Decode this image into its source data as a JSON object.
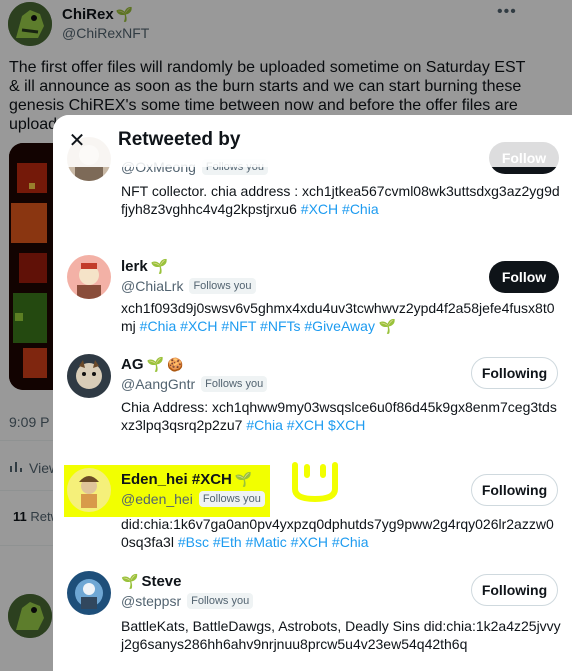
{
  "background_tweet": {
    "author_name": "ChiRex",
    "author_handle": "@ChiRexNFT",
    "more_icon": "more-horizontal-icon",
    "text": "The first offer files will randomly be uploaded sometime on Saturday EST & ill announce as soon as the burn starts and we can start burning these genesis ChiREX's some time between now and before the offer files are upload",
    "time": "9:09 P",
    "views_label": "View",
    "retweet_count": "11",
    "retweets_label": "Retw"
  },
  "modal": {
    "title": "Retweeted by",
    "close_icon": "close-icon",
    "users": [
      {
        "name": "",
        "handle": "@OxMeong",
        "follows_you": "Follows you",
        "bio": "NFT collector. chia address : xch1jtkea567cvml08wk3uttsdxg3az2yg9dfjyh8z3vghhc4v4g2kpstjrxu6",
        "tags": [
          "#XCH",
          "#Chia"
        ],
        "button": "Follow"
      },
      {
        "name": "lerk",
        "handle": "@ChiaLrk",
        "follows_you": "Follows you",
        "bio": "xch1f093d9j0swsv6v5ghmx4xdu4uv3tcwhwvz2ypd4f2a58jefe4fusx8t0mj",
        "tags": [
          "#Chia",
          "#XCH",
          "#NFT",
          "#NFTs",
          "#GiveAway"
        ],
        "button": "Follow"
      },
      {
        "name": "AG",
        "handle": "@AangGntr",
        "follows_you": "Follows you",
        "bio": "Chia Address: xch1qhww9my03wsqslce6u0f86d45k9gx8enm7ceg3tdsxz3lpq3qsrq2p2zu7",
        "tags": [
          "#Chia",
          "#XCH",
          "$XCH"
        ],
        "button": "Following"
      },
      {
        "name": "Eden_hei #XCH",
        "handle": "@eden_hei",
        "follows_you": "Follows you",
        "bio": "did:chia:1k6v7ga0an0pv4yxpzq0dphutds7yg9pww2g4rqy026lr2azzw00sq3fa3l",
        "tags": [
          "#Bsc",
          "#Eth",
          "#Matic",
          "#XCH",
          "#Chia"
        ],
        "button": "Following"
      },
      {
        "name": "Steve",
        "handle": "@steppsr",
        "follows_you": "Follows you",
        "bio": "BattleKats, BattleDawgs, Astrobots, Deadly Sins did:chia:1k2a4z25jvvyj2g6sanys286hh6ahv9nrjnuu8prcw5u4v23ew54q42th6q",
        "tags": [],
        "button": "Following"
      }
    ]
  },
  "colors": {
    "link": "#1d9bf0",
    "highlight": "#f2ff00",
    "sprout": "#3ba55d"
  }
}
